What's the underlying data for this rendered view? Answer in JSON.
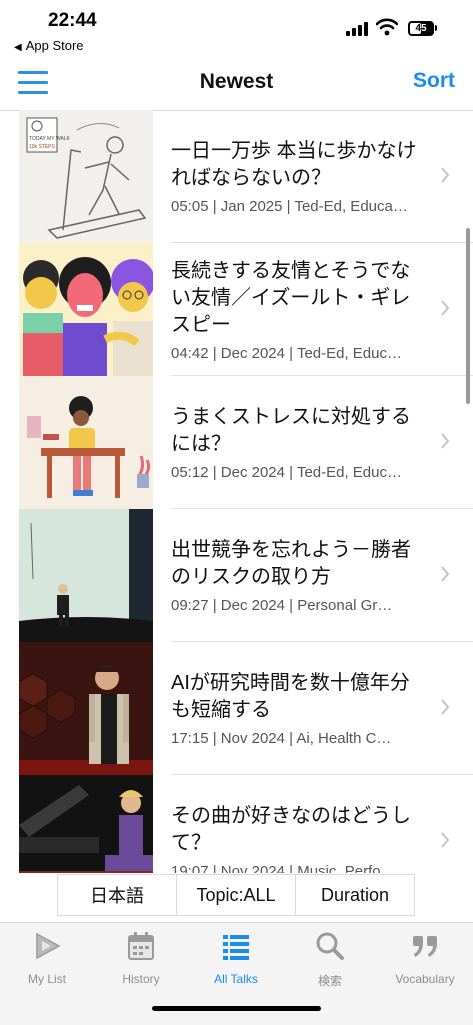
{
  "status_bar": {
    "time": "22:44",
    "back_app": "App Store",
    "battery": "45"
  },
  "nav": {
    "title": "Newest",
    "sort_label": "Sort",
    "menu_icon": "hamburger-menu-icon"
  },
  "talks": [
    {
      "title": "一日一万歩 本当に歩かなければならないの？",
      "meta": "05:05 | Jan 2025 | Ted-Ed, Educa…"
    },
    {
      "title": "長続きする友情とそうでない友情／イズールト・ギレスピー",
      "meta": "04:42 | Dec 2024 | Ted-Ed, Educ…"
    },
    {
      "title": "うまくストレスに対処するには？",
      "meta": "05:12 | Dec 2024 | Ted-Ed, Educ…"
    },
    {
      "title": "出世競争を忘れよう－勝者のリスクの取り方",
      "meta": "09:27 | Dec 2024 | Personal Gr…"
    },
    {
      "title": "AIが研究時間を数十億年分も短縮する",
      "meta": "17:15 | Nov 2024 | Ai, Health C…"
    },
    {
      "title": "その曲が好きなのはどうして？",
      "meta": "19:07 | Nov 2024 | Music, Perfo…"
    }
  ],
  "thumb_texts": {
    "walk_sign": "TODAY MY WALK",
    "walk_steps": "10k STEPS"
  },
  "filters": {
    "language": "日本語",
    "topic": "Topic:ALL",
    "duration": "Duration"
  },
  "tabs": [
    {
      "label": "My List",
      "icon": "play-triangle-icon"
    },
    {
      "label": "History",
      "icon": "calendar-icon"
    },
    {
      "label": "All Talks",
      "icon": "list-icon",
      "active": true
    },
    {
      "label": "検索",
      "icon": "search-icon"
    },
    {
      "label": "Vocabulary",
      "icon": "quote-icon"
    }
  ],
  "colors": {
    "accent": "#1a8cf0",
    "tab_inactive": "#8e8e8e",
    "divider": "#e1e1e1"
  }
}
